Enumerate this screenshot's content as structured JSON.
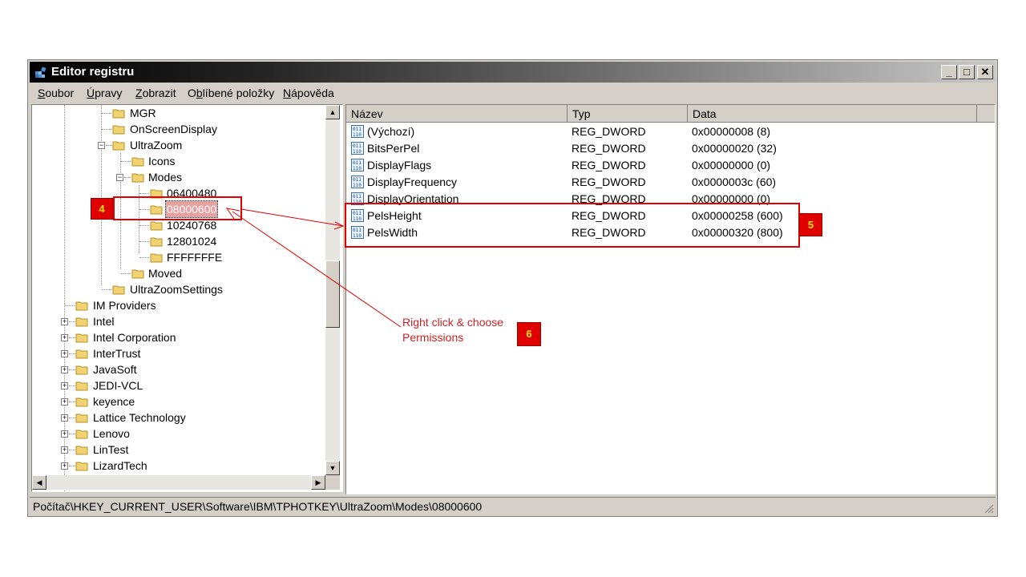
{
  "window": {
    "title": "Editor registru",
    "controls": {
      "minimize": "_",
      "maximize": "□",
      "close": "✕"
    }
  },
  "menu": {
    "items": [
      {
        "pre": "",
        "u": "S",
        "post": "oubor"
      },
      {
        "pre": "",
        "u": "Ú",
        "post": "pravy"
      },
      {
        "pre": "",
        "u": "Z",
        "post": "obrazit"
      },
      {
        "pre": "O",
        "u": "b",
        "post": "líbené položky"
      },
      {
        "pre": "",
        "u": "N",
        "post": "ápověda"
      }
    ]
  },
  "tree": {
    "items": [
      {
        "label": "MGR"
      },
      {
        "label": "OnScreenDisplay"
      },
      {
        "label": "UltraZoom",
        "expander": "−"
      },
      {
        "label": "Icons"
      },
      {
        "label": "Modes",
        "expander": "−"
      },
      {
        "label": "06400480"
      },
      {
        "label": "08000600",
        "selected": true
      },
      {
        "label": "10240768"
      },
      {
        "label": "12801024"
      },
      {
        "label": "FFFFFFFE"
      },
      {
        "label": "Moved"
      },
      {
        "label": "UltraZoomSettings"
      },
      {
        "label": "IM Providers"
      },
      {
        "label": "Intel",
        "expander": "+"
      },
      {
        "label": "Intel Corporation",
        "expander": "+"
      },
      {
        "label": "InterTrust",
        "expander": "+"
      },
      {
        "label": "JavaSoft",
        "expander": "+"
      },
      {
        "label": "JEDI-VCL",
        "expander": "+"
      },
      {
        "label": "keyence",
        "expander": "+"
      },
      {
        "label": "Lattice Technology",
        "expander": "+"
      },
      {
        "label": "Lenovo",
        "expander": "+"
      },
      {
        "label": "LinTest",
        "expander": "+"
      },
      {
        "label": "LizardTech",
        "expander": "+"
      }
    ]
  },
  "list": {
    "columns": [
      "Název",
      "Typ",
      "Data"
    ],
    "rows": [
      {
        "name": "(Výchozí)",
        "type": "REG_DWORD",
        "data": "0x00000008 (8)"
      },
      {
        "name": "BitsPerPel",
        "type": "REG_DWORD",
        "data": "0x00000020 (32)"
      },
      {
        "name": "DisplayFlags",
        "type": "REG_DWORD",
        "data": "0x00000000 (0)"
      },
      {
        "name": "DisplayFrequency",
        "type": "REG_DWORD",
        "data": "0x0000003c (60)"
      },
      {
        "name": "DisplayOrientation",
        "type": "REG_DWORD",
        "data": "0x00000000 (0)"
      },
      {
        "name": "PelsHeight",
        "type": "REG_DWORD",
        "data": "0x00000258 (600)"
      },
      {
        "name": "PelsWidth",
        "type": "REG_DWORD",
        "data": "0x00000320 (800)"
      }
    ],
    "icon": "reg-dword-icon"
  },
  "status": {
    "path": "Počítač\\HKEY_CURRENT_USER\\Software\\IBM\\TPHOTKEY\\UltraZoom\\Modes\\08000600"
  },
  "annotations": {
    "badge4": "4",
    "badge5": "5",
    "badge6": "6",
    "note_line1": "Right click & choose",
    "note_line2": "Permissions",
    "color": "#e00000"
  }
}
